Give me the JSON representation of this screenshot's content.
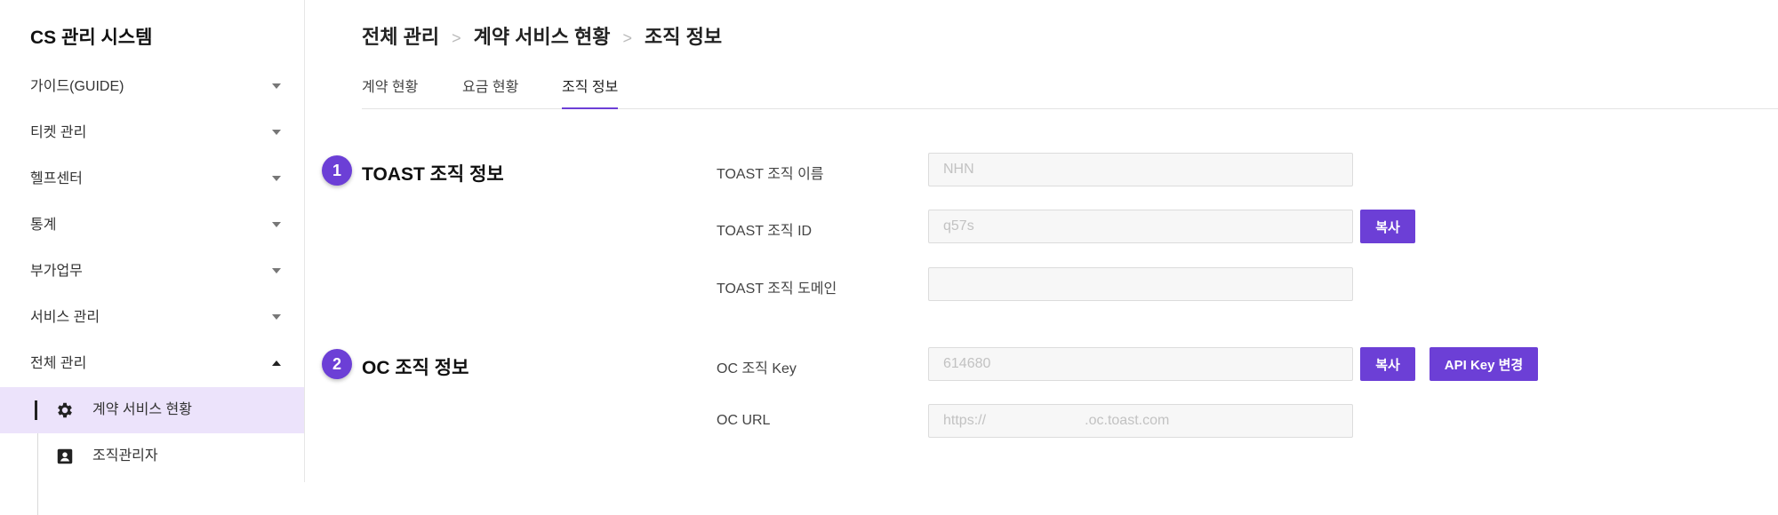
{
  "app": {
    "title": "CS 관리 시스템"
  },
  "sidebar": {
    "items": [
      {
        "label": "가이드(GUIDE)"
      },
      {
        "label": "티켓 관리"
      },
      {
        "label": "헬프센터"
      },
      {
        "label": "통계"
      },
      {
        "label": "부가업무"
      },
      {
        "label": "서비스 관리"
      },
      {
        "label": "전체 관리"
      }
    ],
    "subitems": [
      {
        "label": "계약 서비스 현황",
        "icon": "gear-icon",
        "active": true
      },
      {
        "label": "조직관리자",
        "icon": "contact-card-icon",
        "active": false
      }
    ]
  },
  "breadcrumb": [
    "전체 관리",
    "계약 서비스 현황",
    "조직 정보"
  ],
  "tabs": [
    {
      "label": "계약 현황"
    },
    {
      "label": "요금 현황"
    },
    {
      "label": "조직 정보",
      "active": true
    }
  ],
  "sections": [
    {
      "number": "1",
      "title": "TOAST 조직 정보",
      "fields": [
        {
          "label": "TOAST 조직 이름",
          "value": "NHN"
        },
        {
          "label": "TOAST 조직 ID",
          "value": "q57s",
          "copy_label": "복사"
        },
        {
          "label": "TOAST 조직 도메인",
          "value": ""
        }
      ]
    },
    {
      "number": "2",
      "title": "OC 조직 정보",
      "fields": [
        {
          "label": "OC 조직 Key",
          "value": "614680",
          "copy_label": "복사",
          "api_key_label": "API Key 변경"
        },
        {
          "label": "OC URL",
          "value": "https://                         .oc.toast.com"
        }
      ]
    }
  ],
  "colors": {
    "accent": "#6c3fd6",
    "active_bg": "#ece3fb"
  }
}
